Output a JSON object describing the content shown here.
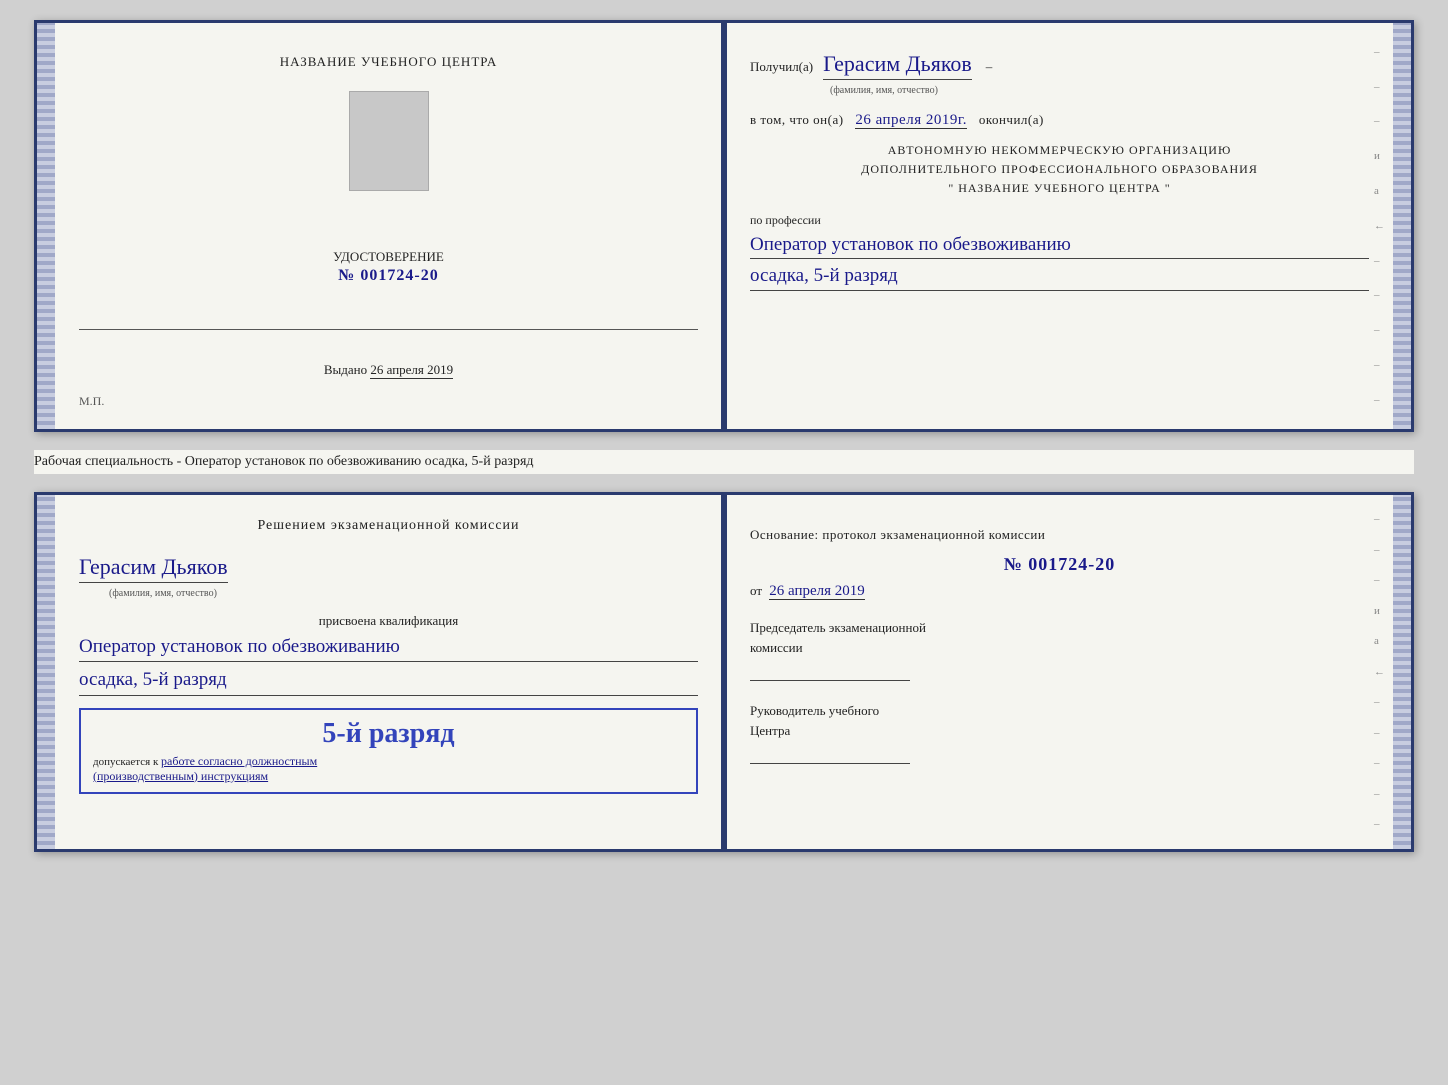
{
  "doc1": {
    "left": {
      "center_name": "НАЗВАНИЕ УЧЕБНОГО ЦЕНТРА",
      "cert_label": "УДОСТОВЕРЕНИЕ",
      "cert_number": "№ 001724-20",
      "issued_label": "Выдано",
      "issued_date": "26 апреля 2019",
      "stamp_label": "М.П."
    },
    "right": {
      "received_prefix": "Получил(а)",
      "recipient_name": "Герасим Дьяков",
      "name_sublabel": "(фамилия, имя, отчество)",
      "in_that_prefix": "в том, что он(а)",
      "completion_date": "26 апреля 2019г.",
      "completion_label": "окончил(а)",
      "org_line1": "АВТОНОМНУЮ НЕКОММЕРЧЕСКУЮ ОРГАНИЗАЦИЮ",
      "org_line2": "ДОПОЛНИТЕЛЬНОГО ПРОФЕССИОНАЛЬНОГО ОБРАЗОВАНИЯ",
      "org_line3": "\"   НАЗВАНИЕ УЧЕБНОГО ЦЕНТРА   \"",
      "profession_label": "по профессии",
      "profession1": "Оператор установок по обезвоживанию",
      "profession2": "осадка, 5-й разряд"
    }
  },
  "specialty_bar": {
    "text": "Рабочая специальность - Оператор установок по обезвоживанию осадка, 5-й разряд"
  },
  "doc2": {
    "left": {
      "decision_title": "Решением экзаменационной комиссии",
      "name": "Герасим Дьяков",
      "name_sublabel": "(фамилия, имя, отчество)",
      "assigned_label": "присвоена квалификация",
      "qualification1": "Оператор установок по обезвоживанию",
      "qualification2": "осадка, 5-й разряд",
      "rank_big": "5-й разряд",
      "allowed_prefix": "допускается к",
      "allowed_text": "работе согласно должностным",
      "allowed_text2": "(производственным) инструкциям"
    },
    "right": {
      "basis_label": "Основание: протокол экзаменационной комиссии",
      "protocol_number": "№  001724-20",
      "date_prefix": "от",
      "date_value": "26 апреля 2019",
      "chairman_label": "Председатель экзаменационной",
      "chairman_label2": "комиссии",
      "director_label": "Руководитель учебного",
      "director_label2": "Центра"
    },
    "right_deco": [
      "–",
      "–",
      "–",
      "и",
      "а",
      "←",
      "–",
      "–",
      "–",
      "–",
      "–"
    ]
  }
}
